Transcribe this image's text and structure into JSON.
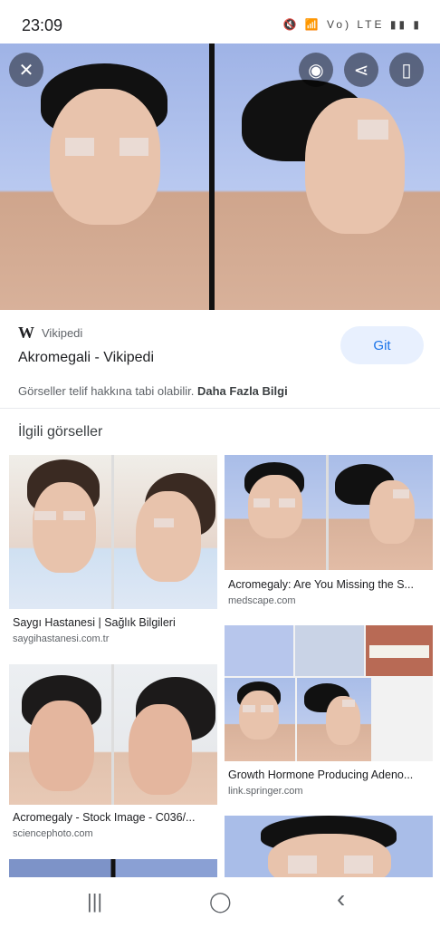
{
  "status": {
    "time": "23:09",
    "icons": "🔇 📶 Vo) LTE ▮▮ ▮"
  },
  "viewer": {
    "close_icon": "close-icon",
    "actions": [
      "lens-icon",
      "share-icon",
      "bookmark-icon"
    ]
  },
  "result": {
    "source": "Vikipedi",
    "title": "Akromegali - Vikipedi",
    "visit_label": "Git",
    "copyright_text": "Görseller telif hakkına tabi olabilir.",
    "more_info": "Daha Fazla Bilgi"
  },
  "related": {
    "header": "İlgili görseller",
    "items": [
      {
        "caption": "Saygı Hastanesi | Sağlık Bilgileri",
        "domain": "saygihastanesi.com.tr"
      },
      {
        "caption": "Acromegaly: Are You Missing the S...",
        "domain": "medscape.com"
      },
      {
        "caption": "Growth Hormone Producing Adeno...",
        "domain": "link.springer.com"
      },
      {
        "caption": "Acromegaly - Stock Image - C036/...",
        "domain": "sciencephoto.com"
      }
    ]
  },
  "nav": {
    "recent": "|||",
    "home": "◯",
    "back": "‹"
  }
}
